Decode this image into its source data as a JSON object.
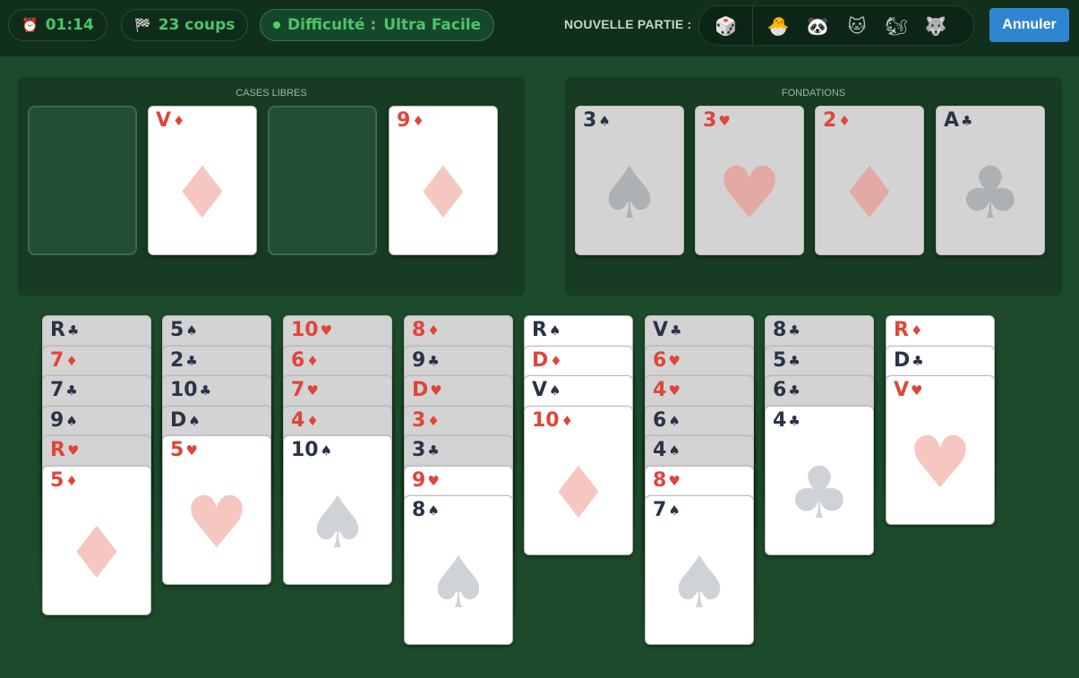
{
  "topbar": {
    "timer": "01:14",
    "timer_icon": "alarm-clock-icon",
    "moves": "23 coups",
    "moves_icon": "checkered-flag-icon",
    "difficulty_label": "Difficulté :",
    "difficulty_value": "Ultra Facile",
    "new_game_label": "NOUVELLE PARTIE :",
    "modes": [
      {
        "name": "random-dice-icon",
        "glyph": "🎲"
      },
      {
        "name": "chick-icon",
        "glyph": "🐣"
      },
      {
        "name": "panda-icon",
        "glyph": "🐼"
      },
      {
        "name": "cat-icon",
        "glyph": "🐱"
      },
      {
        "name": "squirrel-icon",
        "glyph": "🐿"
      },
      {
        "name": "wolf-icon",
        "glyph": "🐺"
      }
    ],
    "undo_label": "Annuler"
  },
  "free_cells": {
    "title": "CASES LIBRES",
    "cells": [
      null,
      {
        "rank": "V",
        "suit": "♦"
      },
      null,
      {
        "rank": "9",
        "suit": "♦"
      }
    ]
  },
  "foundations": {
    "title": "FONDATIONS",
    "piles": [
      {
        "rank": "3",
        "suit": "♠"
      },
      {
        "rank": "3",
        "suit": "♥"
      },
      {
        "rank": "2",
        "suit": "♦"
      },
      {
        "rank": "A",
        "suit": "♣"
      }
    ]
  },
  "tableau": [
    [
      {
        "rank": "R",
        "suit": "♣",
        "dim": true
      },
      {
        "rank": "7",
        "suit": "♦",
        "dim": true
      },
      {
        "rank": "7",
        "suit": "♣",
        "dim": true
      },
      {
        "rank": "9",
        "suit": "♠",
        "dim": true
      },
      {
        "rank": "R",
        "suit": "♥",
        "dim": true
      },
      {
        "rank": "5",
        "suit": "♦",
        "dim": false
      }
    ],
    [
      {
        "rank": "5",
        "suit": "♠",
        "dim": true
      },
      {
        "rank": "2",
        "suit": "♣",
        "dim": true
      },
      {
        "rank": "10",
        "suit": "♣",
        "dim": true
      },
      {
        "rank": "D",
        "suit": "♠",
        "dim": true
      },
      {
        "rank": "5",
        "suit": "♥",
        "dim": false
      }
    ],
    [
      {
        "rank": "10",
        "suit": "♥",
        "dim": true
      },
      {
        "rank": "6",
        "suit": "♦",
        "dim": true
      },
      {
        "rank": "7",
        "suit": "♥",
        "dim": true
      },
      {
        "rank": "4",
        "suit": "♦",
        "dim": true
      },
      {
        "rank": "10",
        "suit": "♠",
        "dim": false
      }
    ],
    [
      {
        "rank": "8",
        "suit": "♦",
        "dim": true
      },
      {
        "rank": "9",
        "suit": "♣",
        "dim": true
      },
      {
        "rank": "D",
        "suit": "♥",
        "dim": true
      },
      {
        "rank": "3",
        "suit": "♦",
        "dim": true
      },
      {
        "rank": "3",
        "suit": "♣",
        "dim": true
      },
      {
        "rank": "9",
        "suit": "♥",
        "dim": false
      },
      {
        "rank": "8",
        "suit": "♠",
        "dim": false
      }
    ],
    [
      {
        "rank": "R",
        "suit": "♠",
        "dim": false
      },
      {
        "rank": "D",
        "suit": "♦",
        "dim": false
      },
      {
        "rank": "V",
        "suit": "♠",
        "dim": false
      },
      {
        "rank": "10",
        "suit": "♦",
        "dim": false
      }
    ],
    [
      {
        "rank": "V",
        "suit": "♣",
        "dim": true
      },
      {
        "rank": "6",
        "suit": "♥",
        "dim": true
      },
      {
        "rank": "4",
        "suit": "♥",
        "dim": true
      },
      {
        "rank": "6",
        "suit": "♠",
        "dim": true
      },
      {
        "rank": "4",
        "suit": "♠",
        "dim": true
      },
      {
        "rank": "8",
        "suit": "♥",
        "dim": false
      },
      {
        "rank": "7",
        "suit": "♠",
        "dim": false
      }
    ],
    [
      {
        "rank": "8",
        "suit": "♣",
        "dim": true
      },
      {
        "rank": "5",
        "suit": "♣",
        "dim": true
      },
      {
        "rank": "6",
        "suit": "♣",
        "dim": true
      },
      {
        "rank": "4",
        "suit": "♣",
        "dim": false
      }
    ],
    [
      {
        "rank": "R",
        "suit": "♦",
        "dim": false
      },
      {
        "rank": "D",
        "suit": "♣",
        "dim": false
      },
      {
        "rank": "V",
        "suit": "♥",
        "dim": false
      }
    ]
  ]
}
